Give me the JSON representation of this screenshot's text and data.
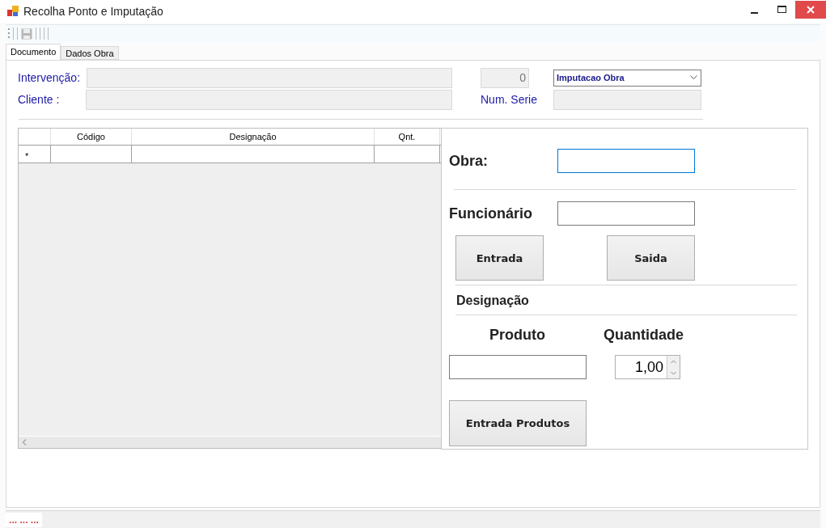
{
  "window": {
    "title": "Recolha Ponto e Imputação"
  },
  "toolbar": {
    "save_disabled": true
  },
  "tabs": [
    {
      "label": "Documento",
      "selected": true
    },
    {
      "label": "Dados Obra",
      "selected": false
    }
  ],
  "header": {
    "intervencao_label": "Intervenção:",
    "cliente_label": "Cliente :",
    "number_value": "0",
    "type_select": "Imputacao Obra",
    "num_serie_label": "Num. Serie"
  },
  "grid": {
    "columns": [
      "Código",
      "Designação",
      "Qnt."
    ],
    "new_row_marker": "*"
  },
  "panel": {
    "obra_label": "Obra:",
    "obra_focused": true,
    "funcionario_label": "Funcionário",
    "entrada_button": "Entrada",
    "saida_button": "Saida",
    "designacao_heading": "Designação",
    "produto_label": "Produto",
    "quantidade_label": "Quantidade",
    "quantidade_value": "1,00",
    "submit_button": "Entrada Produtos"
  },
  "status_bar": {
    "text": "... ... ..."
  }
}
